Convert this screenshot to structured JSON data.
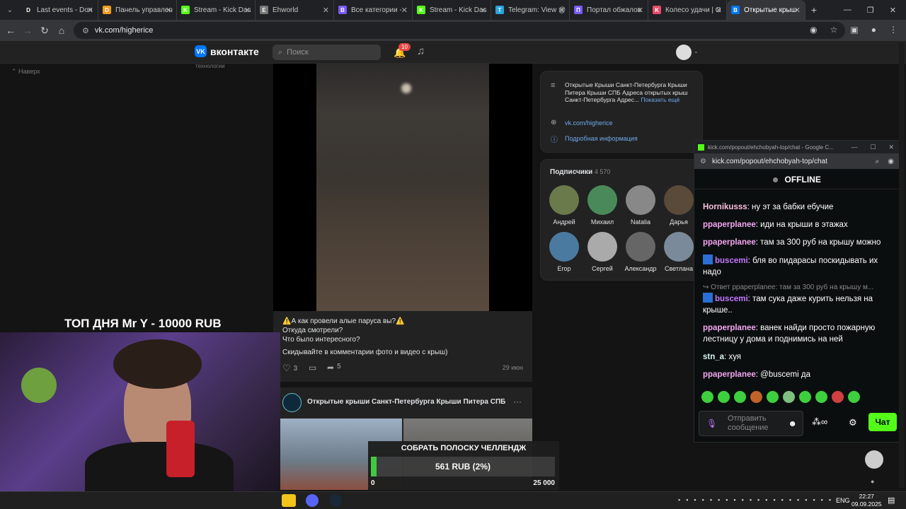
{
  "tabs": [
    {
      "label": "Last events - Don",
      "fav": "D",
      "color": "#222"
    },
    {
      "label": "Панель управлен",
      "fav": "D",
      "color": "#f49b1e"
    },
    {
      "label": "Stream - Kick Das",
      "fav": "K",
      "color": "#53fc18"
    },
    {
      "label": "Ehworld",
      "fav": "E",
      "color": "#777"
    },
    {
      "label": "Все категории - ",
      "fav": "B",
      "color": "#7a5af8"
    },
    {
      "label": "Stream - Kick Das",
      "fav": "K",
      "color": "#53fc18"
    },
    {
      "label": "Telegram: View @",
      "fav": "T",
      "color": "#2aa3dd"
    },
    {
      "label": "Портал обжалов",
      "fav": "П",
      "color": "#7a5af8"
    },
    {
      "label": "Колесо удачи | O",
      "fav": "K",
      "color": "#e84a6a"
    },
    {
      "label": "Открытые крыш",
      "fav": "B",
      "color": "#0077ff"
    }
  ],
  "browser": {
    "url": "vk.com/higherice"
  },
  "vk": {
    "logo": "вконтакте",
    "search_placeholder": "Поиск",
    "notif_count": "10",
    "naverh": "Наверх",
    "technologies": "технологии"
  },
  "post": {
    "line1": "⚠️А как провели алые паруса вы?⚠️",
    "line2": "Откуда смотрели?",
    "line3": "Что было интересного?",
    "line4": "Скидывайте в комментарии фото и видео с крыш)",
    "likes": "3",
    "shares": "5",
    "date": "29 июн"
  },
  "post2": {
    "group": "Открытые крыши Санкт-Петербурга Крыши Питера СПБ",
    "more": "···"
  },
  "info": {
    "desc": "Открытые Крыши Санкт-Петербурга Крыши Питера Крыши СПБ Адреса открытых крыш Санкт-Петербурга Адрес...",
    "show": "Показать ещё",
    "link": "vk.com/higherice",
    "details": "Подробная информация"
  },
  "subscribers": {
    "title": "Подписчики",
    "count": "4 570",
    "people": [
      "Андрей",
      "Михаил",
      "Natalia",
      "Дарья",
      "Егор",
      "Сергей",
      "Александр",
      "Светлана"
    ]
  },
  "overlay": {
    "top_day": "ТОП ДНЯ Mr Y - 10000 RUB",
    "challenge": "СОБРАТЬ ПОЛОСКУ ЧЕЛЛЕНДЖ",
    "amount": "561 RUB (2%)",
    "progress": 0.02,
    "min": "0",
    "max": "25 000"
  },
  "kick": {
    "window_title": "kick.com/popout/ehchobyah-top/chat - Google C...",
    "url": "kick.com/popout/ehchobyah-top/chat",
    "status": "OFFLINE",
    "messages": [
      {
        "user": "Hornikusss",
        "text": "ну эт за бабки ебучие"
      },
      {
        "user": "ppaperplanee",
        "text": "иди на крыши в этажах"
      },
      {
        "user": "ppaperplanee",
        "text": "там за 300 руб на крышу можно"
      },
      {
        "user": "buscemi",
        "text": "бля во пидарасы поскидывать их надо"
      },
      {
        "reply": "Ответ ppaperplanee: там за 300 руб на крышу м..."
      },
      {
        "user": "buscemi",
        "text": "там сука даже курить нельзя на крыше.."
      },
      {
        "user": "ppaperplanee",
        "text": "ванек найди просто пожарную лестницу у дома и поднимись на ней"
      },
      {
        "user": "stn_a",
        "text": "хуя"
      },
      {
        "user": "ppaperplanee",
        "text": "@buscemi да"
      }
    ],
    "send_placeholder": "Отправить сообщение",
    "chat_button": "Чат"
  },
  "taskbar": {
    "lang": "ENG",
    "time": "22:27",
    "date": "09.09.2025"
  }
}
